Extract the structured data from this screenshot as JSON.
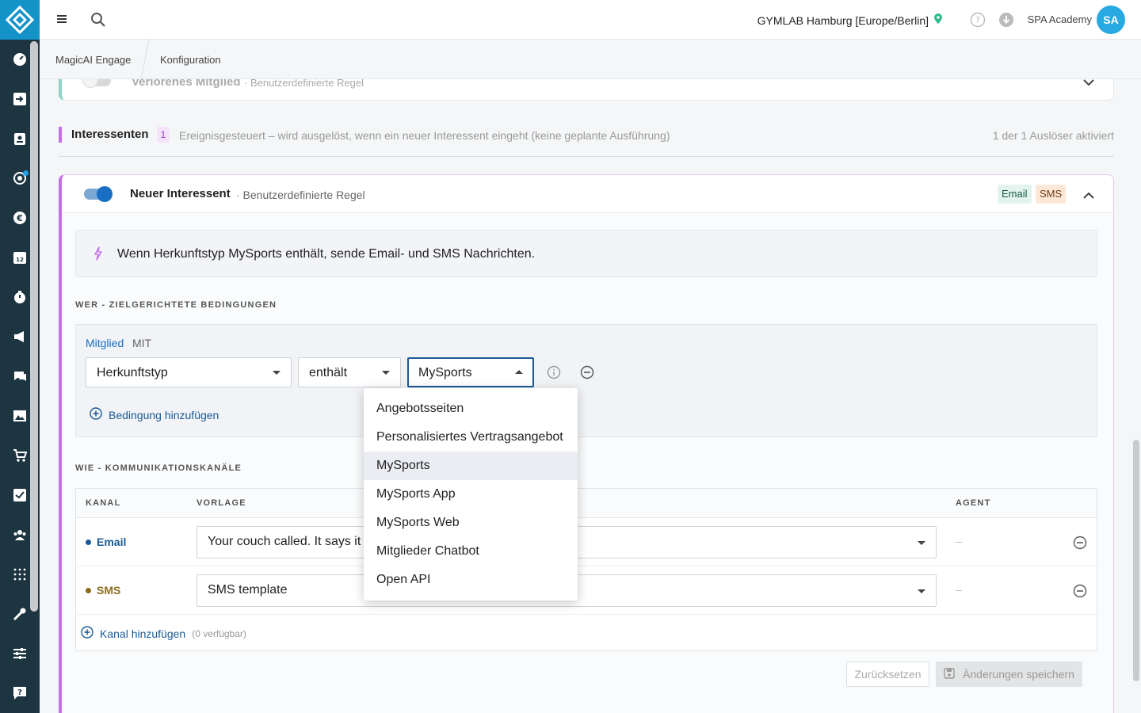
{
  "topbar": {
    "location": "GYMLAB Hamburg [Europe/Berlin]",
    "user_name": "SPA Academy",
    "avatar_initials": "SA"
  },
  "breadcrumb": [
    "MagicAI Engage",
    "Konfiguration"
  ],
  "previous_rule": {
    "title": "Verlorenes Mitglied",
    "subtitle": "· Benutzerdefinierte Regel"
  },
  "section": {
    "title": "Interessenten",
    "count": "1",
    "description": "Ereignisgesteuert – wird ausgelöst, wenn ein neuer Interessent eingeht (keine geplante Ausführung)",
    "activated": "1 der 1 Auslöser aktiviert"
  },
  "rule": {
    "title": "Neuer Interessent",
    "subtitle": "· Benutzerdefinierte Regel",
    "badges": [
      "Email",
      "SMS"
    ],
    "enabled": true,
    "summary": "Wenn Herkunftstyp MySports enthält, sende Email- und SMS Nachrichten."
  },
  "who": {
    "heading": "WER - ZIELGERICHTETE BEDINGUNGEN",
    "member_label": "Mitglied",
    "mit_label": "MIT",
    "field": "Herkunftstyp",
    "operator": "enthält",
    "value": "MySports",
    "add_condition": "Bedingung hinzufügen"
  },
  "how": {
    "heading": "WIE - KOMMUNIKATIONSKANÄLE",
    "columns": [
      "KANAL",
      "VORLAGE",
      "AGENT"
    ],
    "rows": [
      {
        "channel": "Email",
        "template": "Your couch called. It says it",
        "agent": "–",
        "color": "#1a5a96"
      },
      {
        "channel": "SMS",
        "template": "SMS template",
        "agent": "–",
        "color": "#8a6d1a"
      }
    ],
    "add_channel": "Kanal hinzufügen",
    "add_channel_note": "(0 verfügbar)"
  },
  "actions": {
    "reset": "Zurücksetzen",
    "save": "Änderungen speichern"
  },
  "dropdown": {
    "options": [
      "Angebotsseiten",
      "Personalisiertes Vertragsangebot",
      "MySports",
      "MySports App",
      "MySports Web",
      "Mitglieder Chatbot",
      "Open API"
    ],
    "selected": "MySports"
  },
  "colors": {
    "rail": "#1d3441",
    "brand": "#1493c9",
    "accent": "#c46ee8",
    "link": "#1a5a96"
  }
}
